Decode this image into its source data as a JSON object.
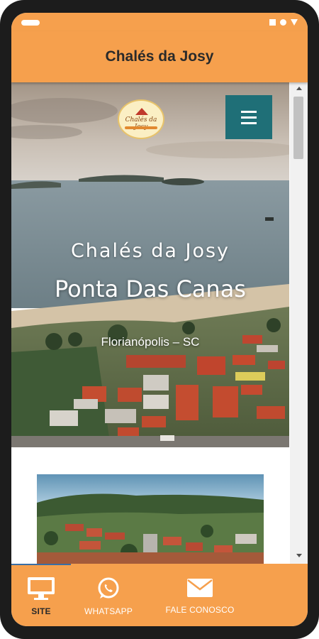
{
  "app": {
    "title": "Chalés da Josy"
  },
  "logo": {
    "text": "Chalés da Josy"
  },
  "hero": {
    "subtitle": "Chalés da Josy",
    "title": "Ponta Das Canas",
    "location": "Florianópolis – SC"
  },
  "bottom_nav": {
    "items": [
      {
        "label": "SITE",
        "icon": "monitor-icon",
        "active": true
      },
      {
        "label": "WHATSAPP",
        "icon": "whatsapp-icon",
        "active": false
      },
      {
        "label": "FALE CONOSCO",
        "icon": "mail-icon",
        "active": false
      }
    ]
  },
  "colors": {
    "app_bar": "#f6a04d",
    "menu_button": "#1f6f77",
    "active_tab_indicator": "#3a6ea5"
  }
}
